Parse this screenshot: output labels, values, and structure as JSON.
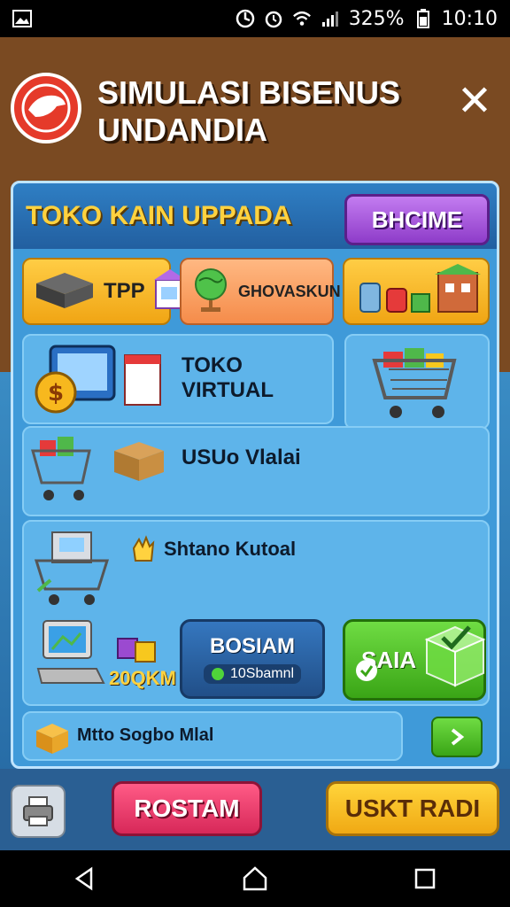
{
  "status": {
    "battery_text": "325%",
    "time": "10:10"
  },
  "header": {
    "title_line1": "SIMULASI BISENUS",
    "title_line2": "UNDANDIA",
    "close_glyph": "✕"
  },
  "panel": {
    "shop_title": "TOKO KAIN UPPADA",
    "top_button": "BHCIME",
    "categories": [
      {
        "label": "TPP",
        "icon": "box-icon"
      },
      {
        "label": "GHOVASKUN",
        "icon": "globe-icon"
      },
      {
        "label": "",
        "icon": "supplies-icon"
      }
    ],
    "cards": {
      "virtual_store": "TOKO VIRTUAL",
      "usaha": "USUo Vlalai",
      "stock": "Shtano Kutoal",
      "price": "20QKM",
      "bottom_row": "Mtto Sogbo Mlal"
    },
    "blue_button": {
      "label": "BOSIAM",
      "sub": "10Sbamnl"
    },
    "green_button": {
      "label": "SAIA"
    }
  },
  "footer": {
    "red_button": "ROSTAM",
    "yellow_button": "USKT RADI"
  },
  "colors": {
    "brand_red": "#e53a2a",
    "accent_yellow": "#ffd23f",
    "panel_blue": "#3f9ad9"
  }
}
